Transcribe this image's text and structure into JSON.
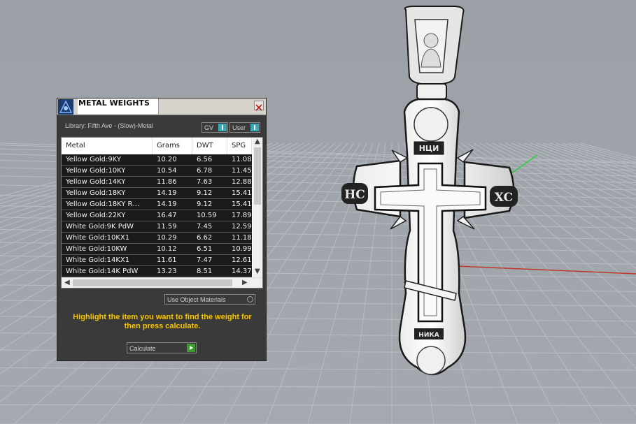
{
  "panel": {
    "title": "METAL WEIGHTS",
    "library": "Library: Fifth Ave - (Slow)-Metal",
    "dropdown_gv": "GV",
    "dropdown_user": "User",
    "use_object_materials": "Use Object Materials",
    "instruction": "Highlight the item you want to find the weight for then press calculate.",
    "calculate_label": "Calculate",
    "close_glyph": "✕"
  },
  "table": {
    "headers": [
      "Metal",
      "Grams",
      "DWT",
      "SPG"
    ],
    "rows": [
      [
        "Yellow Gold:9KY",
        "10.20",
        "6.56",
        "11.08"
      ],
      [
        "Yellow Gold:10KY",
        "10.54",
        "6.78",
        "11.45"
      ],
      [
        "Yellow Gold:14KY",
        "11.86",
        "7.63",
        "12.88"
      ],
      [
        "Yellow Gold:18KY",
        "14.19",
        "9.12",
        "15.41"
      ],
      [
        "Yellow Gold:18KY R…",
        "14.19",
        "9.12",
        "15.41"
      ],
      [
        "Yellow Gold:22KY",
        "16.47",
        "10.59",
        "17.89"
      ],
      [
        "White Gold:9K PdW",
        "11.59",
        "7.45",
        "12.59"
      ],
      [
        "White Gold:10KX1",
        "10.29",
        "6.62",
        "11.18"
      ],
      [
        "White Gold:10KW",
        "10.12",
        "6.51",
        "10.99"
      ],
      [
        "White Gold:14KX1",
        "11.61",
        "7.47",
        "12.61"
      ],
      [
        "White Gold:14K PdW",
        "13.23",
        "8.51",
        "14.37"
      ]
    ]
  },
  "viewport": {
    "cross_left": "HC",
    "cross_right": "XC",
    "cross_top": "НЦИ",
    "cross_bottom": "НИКА"
  },
  "colors": {
    "background": "#9da3a9",
    "panel": "#3a3a3a",
    "accent_teal": "#3aa7b5",
    "instruction_text": "#f5c300",
    "calculate_green": "#3d9b2f",
    "axis_red": "#c0392b",
    "axis_green": "#2ecc40"
  },
  "icons": [
    "app-logo-icon",
    "close-icon",
    "scroll-up-icon",
    "scroll-down-icon",
    "scroll-left-icon",
    "scroll-right-icon",
    "go-icon"
  ]
}
